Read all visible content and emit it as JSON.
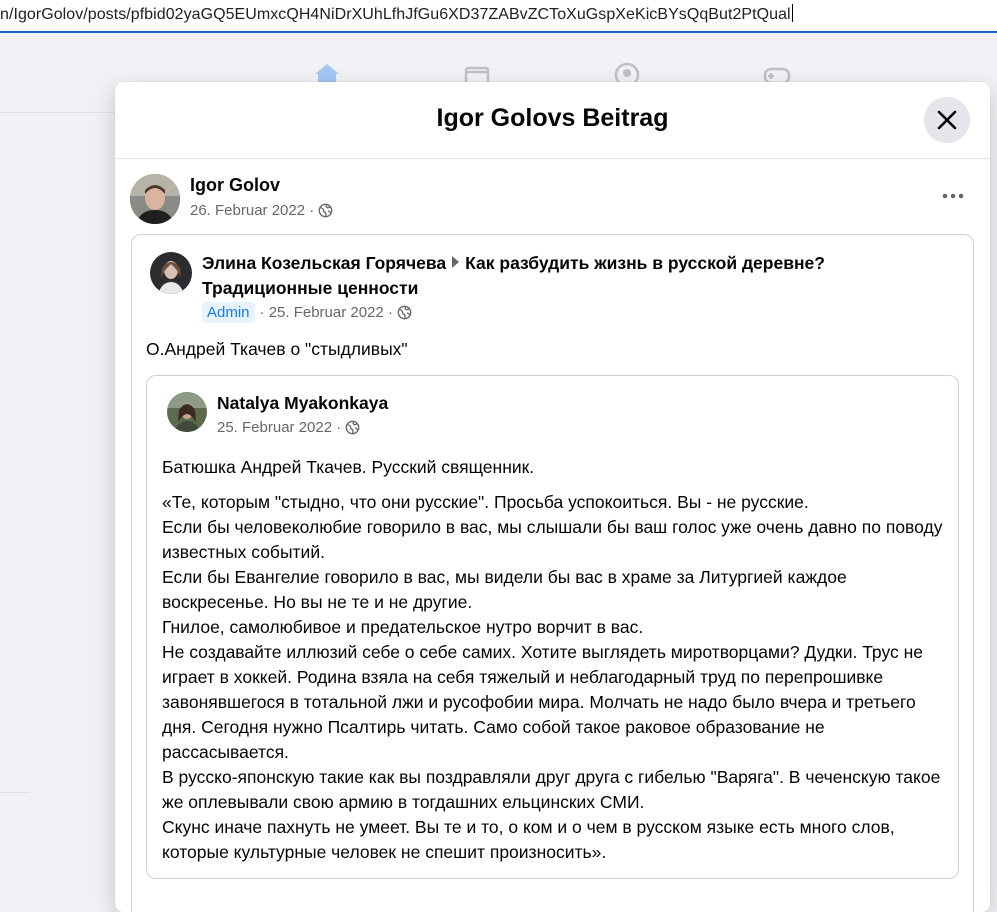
{
  "browser": {
    "url": "n/IgorGolov/posts/pfbid02yaGQ5EUmxcQH4NiDrXUhLfhJfGu6XD37ZABvZCToXuGspXeKicBYsQqBut2PtQual"
  },
  "modal": {
    "title": "Igor Golovs Beitrag"
  },
  "post": {
    "author": "Igor Golov",
    "date": "26. Februar 2022 ·"
  },
  "shared_group_post": {
    "author": "Элина Козельская Горячева",
    "group": "Как разбудить жизнь в русской деревне? Традиционные ценности",
    "badge": "Admin",
    "date": "· 25. Februar 2022 ·",
    "text": "О.Андрей Ткачев о \"стыдливых\""
  },
  "original_post": {
    "author": "Natalya Myakonkaya",
    "date": "25. Februar 2022 ·",
    "paragraph1": "Батюшка Андрей Ткачев. Русский священник.",
    "lines": [
      "«Те, которым \"стыдно, что они русские\". Просьба успокоиться. Вы - не русские.",
      "Если бы человеколюбие говорило в вас, мы слышали бы ваш голос уже очень давно по поводу известных событий.",
      "Если бы Евангелие говорило в вас, мы видели бы вас в храме за Литургией каждое воскресенье. Но вы не те и не другие.",
      "Гнилое, самолюбивое и предательское нутро ворчит в вас.",
      "Не создавайте иллюзий себе о себе самих. Хотите выглядеть миротворцами? Дудки. Трус не играет в хоккей. Родина взяла на себя тяжелый и неблагодарный труд по перепрошивке завонявшегося в тотальной лжи и русофобии мира. Молчать не надо было вчера и третьего дня. Сегодня нужно Псалтирь читать. Само собой такое раковое образование не рассасывается.",
      "В русско-японскую такие как вы поздравляли друг друга с гибелью \"Варяга\". В чеченскую такое же оплевывали свою армию в тогдашних ельцинских СМИ.",
      "Скунс иначе пахнуть не умеет. Вы те и то, о ком и о чем в русском языке есть много слов, которые культурные человек не спешит произносить»."
    ]
  },
  "colors": {
    "accent": "#1877f2",
    "url_underline": "#1a64c8",
    "meta_text": "#65676b"
  }
}
